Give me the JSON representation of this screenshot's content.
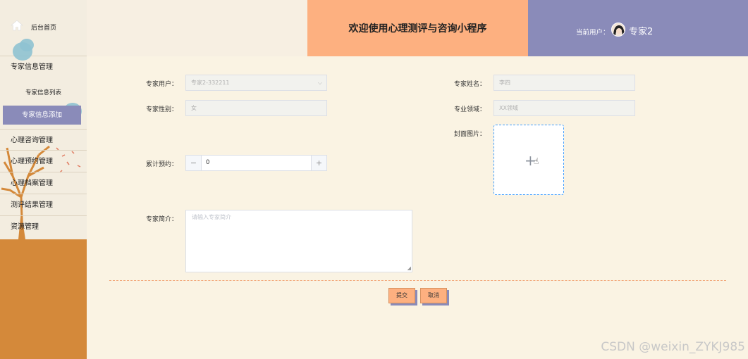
{
  "sidebar": {
    "home_label": "后台首页",
    "menu": [
      {
        "label": "专家信息管理"
      },
      {
        "label": "心理咨询管理"
      },
      {
        "label": "心理预约管理"
      },
      {
        "label": "心理档案管理"
      },
      {
        "label": "测评结果管理"
      },
      {
        "label": "资源管理"
      }
    ],
    "sub": {
      "list_label": "专家信息列表",
      "add_label": "专家信息添加"
    }
  },
  "header": {
    "title": "欢迎使用心理测评与咨询小程序",
    "user_label": "当前用户：",
    "user_name": "专家2"
  },
  "form": {
    "user_label": "专家用户：",
    "user_value": "专家2-332211",
    "name_label": "专家姓名：",
    "name_value": "李四",
    "gender_label": "专家性别：",
    "gender_value": "女",
    "field_label": "专业领域：",
    "field_value": "XX领域",
    "cover_label": "封面图片：",
    "count_label": "累计预约：",
    "count_value": "0",
    "intro_label": "专家简介：",
    "intro_placeholder": "请输入专家简介",
    "submit_label": "提交",
    "cancel_label": "取消"
  },
  "watermark": "CSDN @weixin_ZYKJ985",
  "colors": {
    "accent_orange": "#fdb080",
    "accent_purple": "#8a8bb9",
    "sidebar_bottom": "#d4893a",
    "background": "#faf3e3"
  }
}
